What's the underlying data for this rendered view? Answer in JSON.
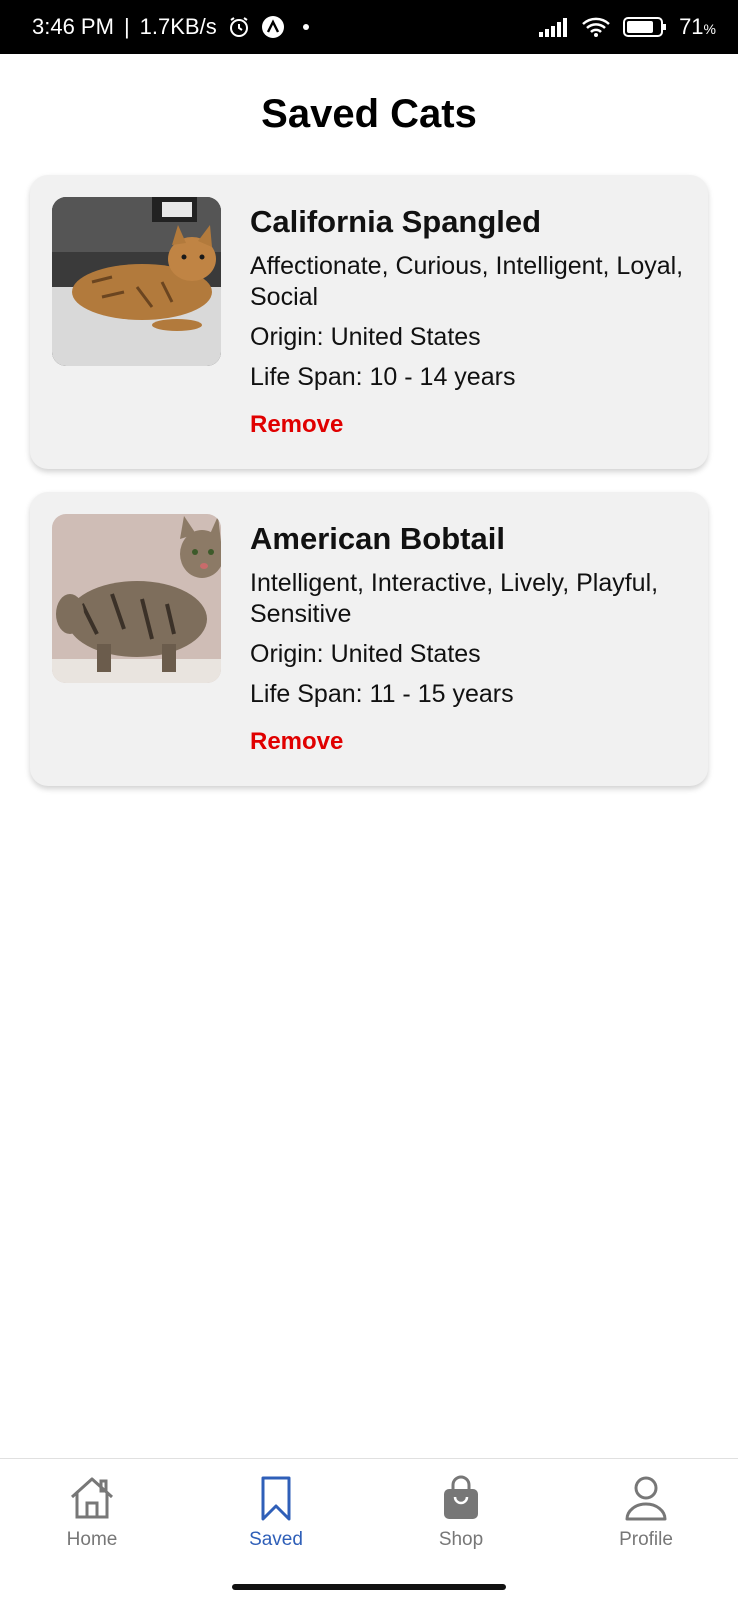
{
  "status_bar": {
    "time": "3:46 PM",
    "separator": "|",
    "net_speed": "1.7KB/s",
    "battery_pct": "71",
    "battery_unit": "%"
  },
  "page": {
    "title": "Saved Cats"
  },
  "cats": [
    {
      "name": "California Spangled",
      "temperament": "Affectionate, Curious, Intelligent, Loyal, Social",
      "origin": "Origin: United States",
      "life_span": "Life Span: 10 - 14 years",
      "remove_label": "Remove"
    },
    {
      "name": "American Bobtail",
      "temperament": "Intelligent, Interactive, Lively, Playful, Sensitive",
      "origin": "Origin: United States",
      "life_span": "Life Span: 11 - 15 years",
      "remove_label": "Remove"
    }
  ],
  "nav": {
    "items": [
      {
        "label": "Home",
        "icon": "home-icon"
      },
      {
        "label": "Saved",
        "icon": "bookmark-icon",
        "active": true
      },
      {
        "label": "Shop",
        "icon": "shopping-bag-icon"
      },
      {
        "label": "Profile",
        "icon": "user-icon"
      }
    ]
  },
  "colors": {
    "accent": "#2f5fb8",
    "remove": "#e00000",
    "card_bg": "#f1f1f1"
  }
}
